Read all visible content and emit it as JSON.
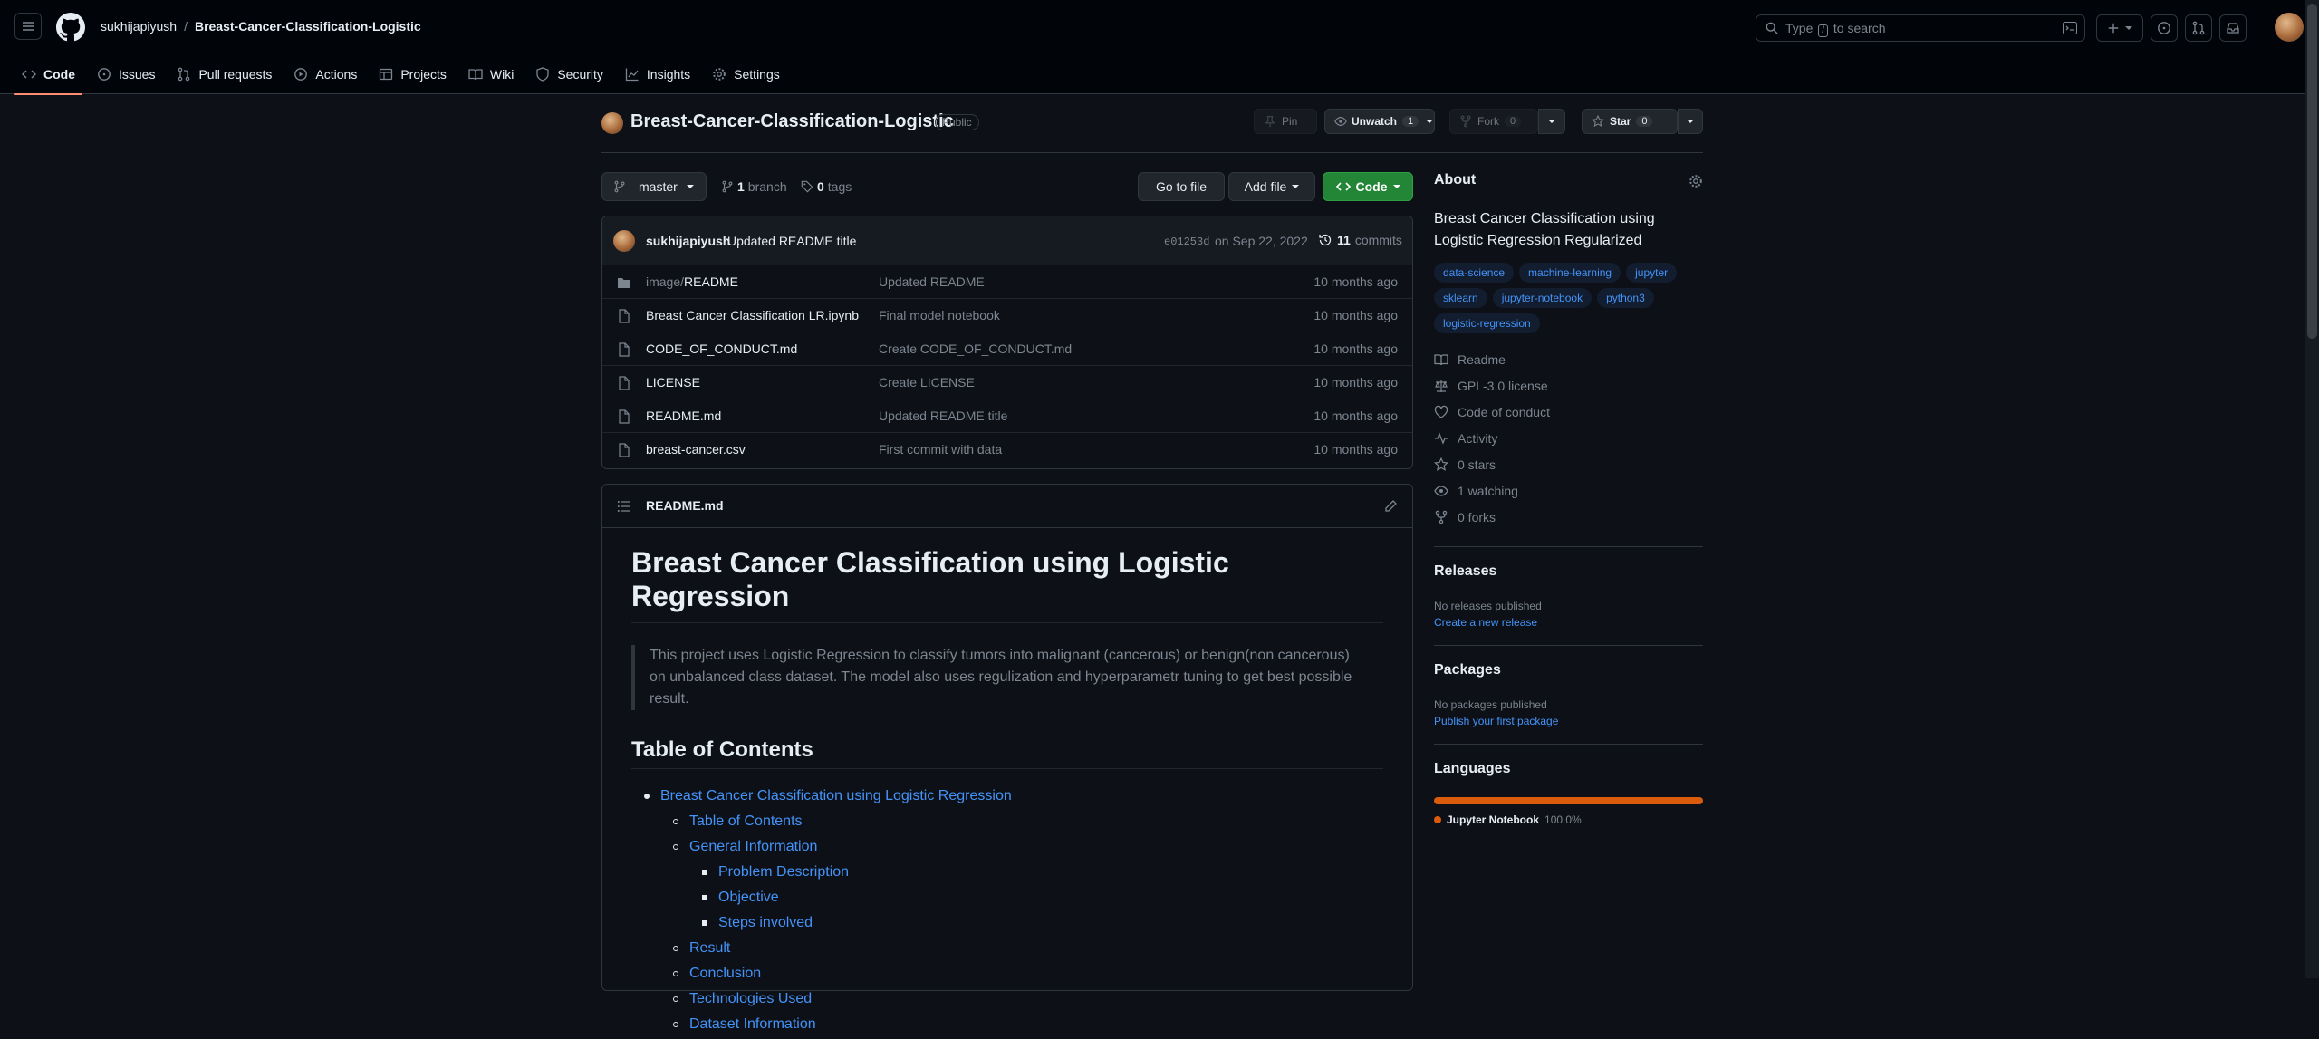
{
  "header": {
    "owner": "sukhijapiyush",
    "separator": "/",
    "repo": "Breast-Cancer-Classification-Logistic",
    "search_prefix": "Type",
    "search_key": "/",
    "search_suffix": "to search"
  },
  "tabs": [
    {
      "label": "Code",
      "icon": "code-icon"
    },
    {
      "label": "Issues",
      "icon": "issue-icon"
    },
    {
      "label": "Pull requests",
      "icon": "pull-request-icon"
    },
    {
      "label": "Actions",
      "icon": "play-icon"
    },
    {
      "label": "Projects",
      "icon": "table-icon"
    },
    {
      "label": "Wiki",
      "icon": "book-icon"
    },
    {
      "label": "Security",
      "icon": "shield-icon"
    },
    {
      "label": "Insights",
      "icon": "graph-icon"
    },
    {
      "label": "Settings",
      "icon": "gear-icon"
    }
  ],
  "repo": {
    "title": "Breast-Cancer-Classification-Logistic",
    "visibility": "Public",
    "pin": "Pin",
    "unwatch": "Unwatch",
    "watch_count": "1",
    "fork": "Fork",
    "fork_count": "0",
    "star": "Star",
    "star_count": "0"
  },
  "branchbar": {
    "branch": "master",
    "branch_count": "1",
    "branch_label": "branch",
    "tag_count": "0",
    "tag_label": "tags",
    "go_to_file": "Go to file",
    "add_file": "Add file",
    "code": "Code"
  },
  "commit": {
    "author": "sukhijapiyush",
    "message": "Updated README title",
    "sha": "e01253d",
    "date": "on Sep 22, 2022",
    "count": "11",
    "count_label": "commits"
  },
  "files": [
    {
      "type": "folder",
      "prefix": "image/",
      "name": "README",
      "commit": "Updated README",
      "age": "10 months ago"
    },
    {
      "type": "file",
      "prefix": "",
      "name": "Breast Cancer Classification LR.ipynb",
      "commit": "Final model notebook",
      "age": "10 months ago"
    },
    {
      "type": "file",
      "prefix": "",
      "name": "CODE_OF_CONDUCT.md",
      "commit": "Create CODE_OF_CONDUCT.md",
      "age": "10 months ago"
    },
    {
      "type": "file",
      "prefix": "",
      "name": "LICENSE",
      "commit": "Create LICENSE",
      "age": "10 months ago"
    },
    {
      "type": "file",
      "prefix": "",
      "name": "README.md",
      "commit": "Updated README title",
      "age": "10 months ago"
    },
    {
      "type": "file",
      "prefix": "",
      "name": "breast-cancer.csv",
      "commit": "First commit with data",
      "age": "10 months ago"
    }
  ],
  "readme": {
    "filename": "README.md",
    "h1": "Breast Cancer Classification using Logistic Regression",
    "quote": "This project uses Logistic Regression to classify tumors into malignant (cancerous) or benign(non cancerous) on unbalanced class dataset. The model also uses regulization and hyperparametr tuning to get best possible result.",
    "toc_title": "Table of Contents",
    "toc": [
      {
        "level": 1,
        "text": "Breast Cancer Classification using Logistic Regression"
      },
      {
        "level": 2,
        "text": "Table of Contents"
      },
      {
        "level": 2,
        "text": "General Information"
      },
      {
        "level": 3,
        "text": "Problem Description"
      },
      {
        "level": 3,
        "text": "Objective"
      },
      {
        "level": 3,
        "text": "Steps involved"
      },
      {
        "level": 2,
        "text": "Result"
      },
      {
        "level": 2,
        "text": "Conclusion"
      },
      {
        "level": 2,
        "text": "Technologies Used"
      },
      {
        "level": 2,
        "text": "Dataset Information"
      }
    ]
  },
  "about": {
    "title": "About",
    "description": "Breast Cancer Classification using Logistic Regression Regularized",
    "topics": [
      "data-science",
      "machine-learning",
      "jupyter",
      "sklearn",
      "jupyter-notebook",
      "python3",
      "logistic-regression"
    ],
    "meta": [
      {
        "icon": "book-icon",
        "label": "Readme"
      },
      {
        "icon": "law-icon",
        "label": "GPL-3.0 license"
      },
      {
        "icon": "heart-icon",
        "label": "Code of conduct"
      },
      {
        "icon": "pulse-icon",
        "label": "Activity"
      },
      {
        "icon": "star-icon",
        "label": "0 stars"
      },
      {
        "icon": "eye-icon",
        "label": "1 watching"
      },
      {
        "icon": "fork-icon",
        "label": "0 forks"
      }
    ]
  },
  "releases": {
    "title": "Releases",
    "empty": "No releases published",
    "link": "Create a new release"
  },
  "packages": {
    "title": "Packages",
    "empty": "No packages published",
    "link": "Publish your first package"
  },
  "languages": {
    "title": "Languages",
    "name": "Jupyter Notebook",
    "percent": "100.0%",
    "share": 1.0,
    "color": "#da5b0b"
  }
}
